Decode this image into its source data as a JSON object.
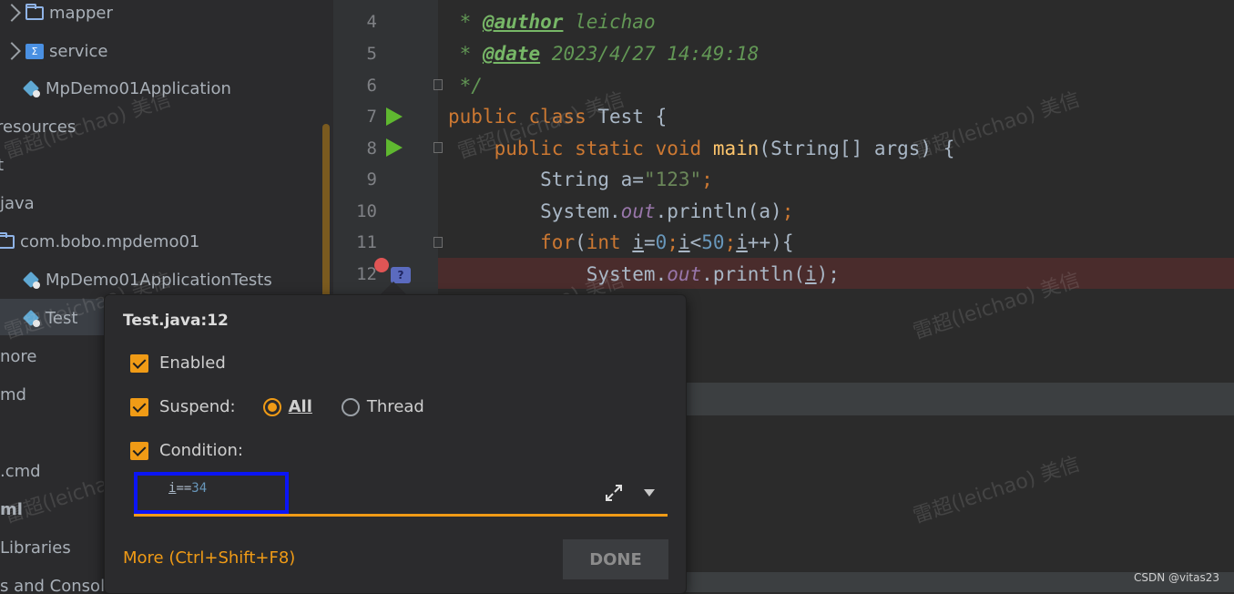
{
  "tree": {
    "items": [
      {
        "label": "mapper"
      },
      {
        "label": "service"
      },
      {
        "label": "MpDemo01Application"
      },
      {
        "label": "resources"
      },
      {
        "label": "t"
      },
      {
        "label": "java"
      },
      {
        "label": "com.bobo.mpdemo01"
      },
      {
        "label": "MpDemo01ApplicationTests"
      },
      {
        "label": "Test"
      },
      {
        "label": "nore"
      },
      {
        "label": "md"
      },
      {
        "label": ".cmd"
      },
      {
        "label": "ml"
      },
      {
        "label": "Libraries"
      },
      {
        "label": "s and Console"
      }
    ]
  },
  "editor": {
    "line_numbers": [
      "4",
      "5",
      "6",
      "7",
      "8",
      "9",
      "10",
      "11",
      "12"
    ],
    "author_tag": "@author",
    "author_value": " leichao",
    "date_tag": "@date",
    "date_value": " 2023/4/27 14:49:18",
    "doc_end": " */",
    "doc_star": " * ",
    "kw_public": "public",
    "kw_class": "class",
    "kw_static": "static",
    "kw_void": "void",
    "class_name": " Test {",
    "fn_main": "main",
    "main_params": "(String[] args) {",
    "line9_a": "String a=",
    "line9_str": "\"123\"",
    "line9_semi": ";",
    "line10_a": "System.",
    "field_out": "out",
    "line10_b": ".println(a)",
    "kw_for": "for",
    "kw_int": "int",
    "var_i": "i",
    "num_0": "0",
    "num_50": "50",
    "line12_b": ".println(",
    "line12_c": ");"
  },
  "popup": {
    "title": "Test.java:12",
    "enabled_label": "Enabled",
    "suspend_label": "Suspend:",
    "all_label": "All",
    "thread_label": "Thread",
    "condition_label": "Condition:",
    "condition_var": "i",
    "condition_op": "==",
    "condition_num": "34",
    "more_label": "More (Ctrl+Shift+F8)",
    "done_label": "DONE"
  },
  "watermark": "雷超(leichao) 美信",
  "csdn": "CSDN @vitas23"
}
